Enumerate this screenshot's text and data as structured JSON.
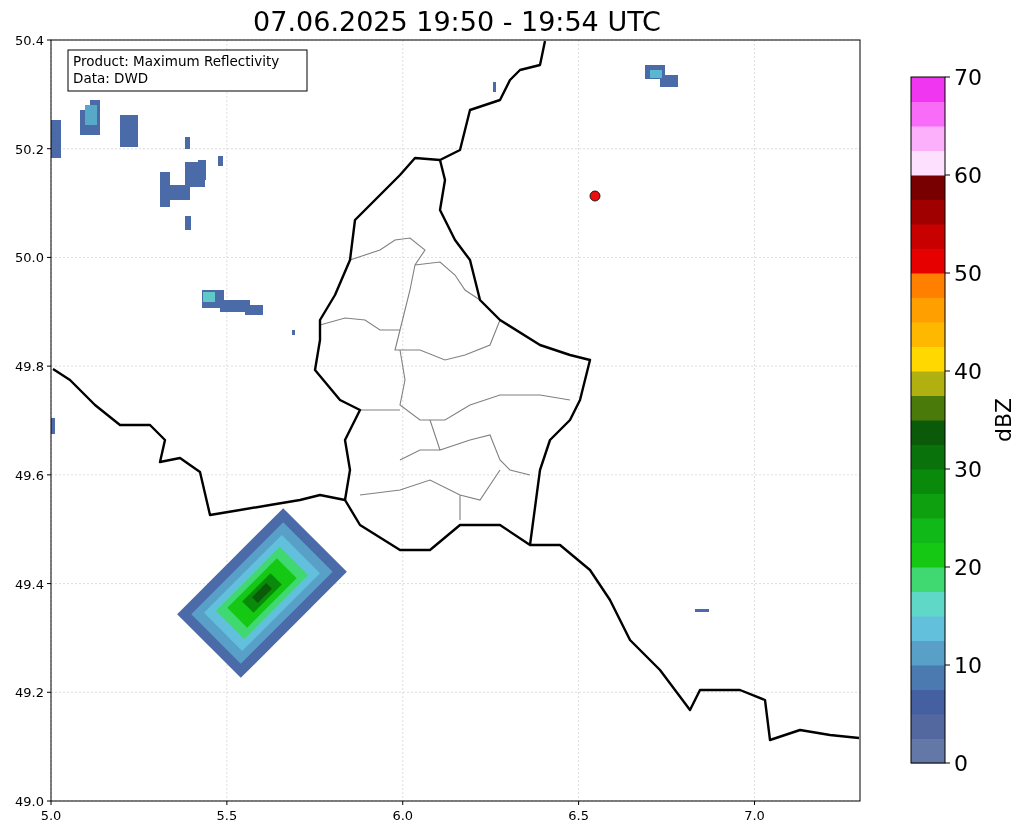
{
  "title": "07.06.2025 19:50 - 19:54 UTC",
  "info_box": [
    "Product: Maximum Reflectivity",
    "Data: DWD"
  ],
  "x_ticks": [
    "5.0",
    "5.5",
    "6.0",
    "6.5",
    "7.0"
  ],
  "y_ticks": [
    "50.4",
    "50.2",
    "50.0",
    "49.8",
    "49.6",
    "49.4",
    "49.2",
    "49.0"
  ],
  "colorbar": {
    "label": "dBZ",
    "ticks": [
      "70",
      "60",
      "50",
      "40",
      "30",
      "20",
      "10",
      "0"
    ],
    "segments": [
      {
        "color": "#6478a8"
      },
      {
        "color": "#5468a0"
      },
      {
        "color": "#4560a0"
      },
      {
        "color": "#4a7ab0"
      },
      {
        "color": "#58a0c8"
      },
      {
        "color": "#62c0dc"
      },
      {
        "color": "#60d8c8"
      },
      {
        "color": "#40d870"
      },
      {
        "color": "#14c814"
      },
      {
        "color": "#10b818"
      },
      {
        "color": "#0ea00e"
      },
      {
        "color": "#0a8a0a"
      },
      {
        "color": "#0a720a"
      },
      {
        "color": "#0a5a0a"
      },
      {
        "color": "#4a7a0a"
      },
      {
        "color": "#b0b010"
      },
      {
        "color": "#ffd800"
      },
      {
        "color": "#ffb800"
      },
      {
        "color": "#ffa000"
      },
      {
        "color": "#ff8000"
      },
      {
        "color": "#e60000"
      },
      {
        "color": "#c80000"
      },
      {
        "color": "#a00000"
      },
      {
        "color": "#780000"
      },
      {
        "color": "#fde0fd"
      },
      {
        "color": "#fcb0fc"
      },
      {
        "color": "#f86cf8"
      },
      {
        "color": "#f036f0"
      }
    ]
  }
}
